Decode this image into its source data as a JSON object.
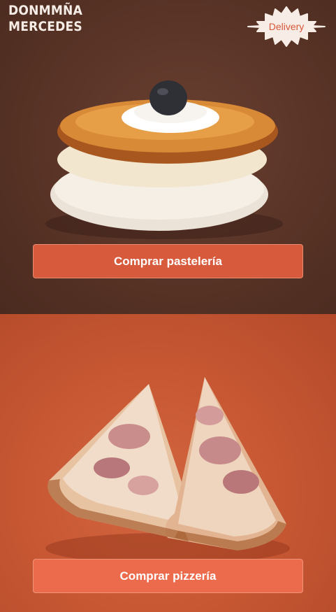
{
  "header": {
    "logo_line1": "DONMMÑA",
    "logo_line2": "MERCEDES",
    "delivery_label": "Delivery"
  },
  "sections": {
    "pastry": {
      "button_label": "Comprar pastelería"
    },
    "pizza": {
      "button_label": "Comprar pizzería"
    }
  },
  "colors": {
    "pastry_bg": "#5a3528",
    "pizza_bg": "#c75733",
    "cta_pastry": "#d75a3c",
    "cta_pizza": "#ec6b4c",
    "delivery_badge": "#f7ede6",
    "delivery_text": "#d8573b"
  }
}
